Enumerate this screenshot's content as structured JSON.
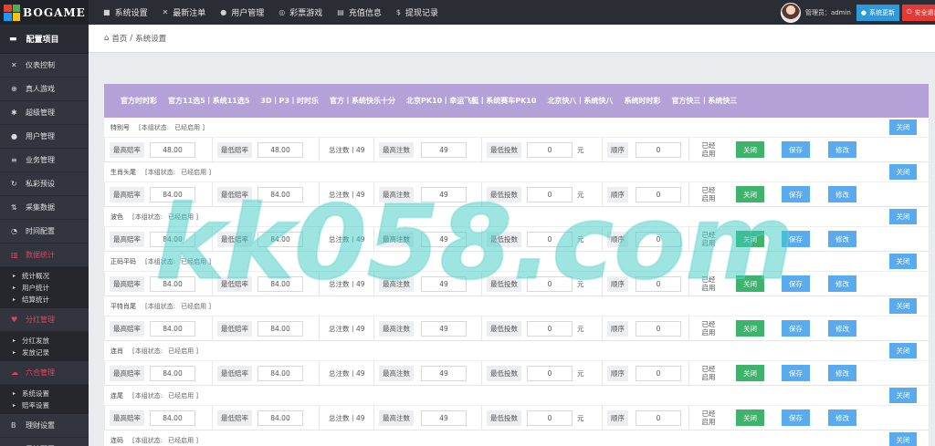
{
  "app": {
    "logo": "BOGAME"
  },
  "topnav": [
    {
      "icon": "settings-icon",
      "glyph": "■",
      "label": "系统设置"
    },
    {
      "icon": "shuffle-icon",
      "glyph": "✕",
      "label": "最新注单"
    },
    {
      "icon": "user-icon",
      "glyph": "●",
      "label": "用户管理"
    },
    {
      "icon": "target-icon",
      "glyph": "◎",
      "label": "彩票游戏"
    },
    {
      "icon": "card-icon",
      "glyph": "▤",
      "label": "充值信息"
    },
    {
      "icon": "money-icon",
      "glyph": "$",
      "label": "提现记录"
    }
  ],
  "topright": {
    "admin": "管理员：admin",
    "update": "系统更新",
    "exit": "安全退出"
  },
  "sidebar": {
    "title": "配置项目",
    "items": [
      {
        "icon": "shuffle-icon",
        "glyph": "✕",
        "label": "仪表控制",
        "active": false
      },
      {
        "icon": "plus-circle-icon",
        "glyph": "⊕",
        "label": "真人游戏",
        "active": false
      },
      {
        "icon": "gear-icon",
        "glyph": "✱",
        "label": "超级管理",
        "active": false
      },
      {
        "icon": "user-circle-icon",
        "glyph": "●",
        "label": "用户管理",
        "active": false
      },
      {
        "icon": "list-icon",
        "glyph": "≡",
        "label": "业务管理",
        "active": false
      },
      {
        "icon": "refresh-icon",
        "glyph": "↻",
        "label": "私彩预设",
        "active": false
      },
      {
        "icon": "sort-icon",
        "glyph": "⇅",
        "label": "采集数据",
        "active": false
      },
      {
        "icon": "dashboard-icon",
        "glyph": "◔",
        "label": "时间配置",
        "active": false
      },
      {
        "icon": "chart-icon",
        "glyph": "▥",
        "label": "数据统计",
        "active": true
      }
    ],
    "sub1": [
      "统计概况",
      "用户统计",
      "结算统计"
    ],
    "item2": {
      "icon": "heart-icon",
      "glyph": "♥",
      "label": "分红管理",
      "active": true
    },
    "sub2": [
      "分红发放",
      "发放记录"
    ],
    "item3": {
      "icon": "cloud-icon",
      "glyph": "☁",
      "label": "六合管理",
      "active": true
    },
    "sub3": [
      "系统设置",
      "赔率设置"
    ],
    "item4": {
      "icon": "bitcoin-icon",
      "glyph": "B",
      "label": "理财设置",
      "active": false
    },
    "item5": {
      "icon": "filter-icon",
      "glyph": "▼",
      "label": "风控配置",
      "active": false
    }
  },
  "breadcrumb": {
    "home": "首页",
    "sep": "/",
    "current": "系统设置"
  },
  "tabs": [
    "官方时时彩",
    "官方11选5丨系统11选5",
    "3D丨P3丨时时乐",
    "官方丨系统快乐十分",
    "北京PK10丨幸运飞艇丨系统赛车PK10",
    "北京快八丨系统快八",
    "系统时时彩",
    "官方快三丨系统快三"
  ],
  "labels": {
    "status_label": "[本组状态:",
    "status_value": "已经启用 ]",
    "group_close": "关闭",
    "max_odds": "最高赔率",
    "min_odds": "最低赔率",
    "total": "总注数丨49",
    "max_bets": "最高注数",
    "min_stake": "最低投数",
    "unit": "元",
    "order": "顺序",
    "enabled": "已经启用",
    "btn_close": "关闭",
    "btn_save": "保存",
    "btn_edit": "修改"
  },
  "groups": [
    {
      "head": "特别号",
      "row": "特别号",
      "max": "48.00",
      "min": "48.00",
      "bets": "49",
      "stake": "0",
      "order": "0"
    },
    {
      "head": "生肖头尾",
      "row": "生肖头尾",
      "max": "84.00",
      "min": "84.00",
      "bets": "49",
      "stake": "0",
      "order": "0"
    },
    {
      "head": "波色",
      "row": "波色",
      "max": "84.00",
      "min": "84.00",
      "bets": "49",
      "stake": "0",
      "order": "0"
    },
    {
      "head": "正码平码",
      "row": "正码平码",
      "max": "84.00",
      "min": "84.00",
      "bets": "49",
      "stake": "0",
      "order": "0"
    },
    {
      "head": "平特肖尾",
      "row": "平特肖尾",
      "max": "84.00",
      "min": "84.00",
      "bets": "49",
      "stake": "0",
      "order": "0"
    },
    {
      "head": "连肖",
      "row": "连肖",
      "max": "84.00",
      "min": "84.00",
      "bets": "49",
      "stake": "0",
      "order": "0"
    },
    {
      "head": "连尾",
      "row": "连尾",
      "max": "84.00",
      "min": "84.00",
      "bets": "49",
      "stake": "0",
      "order": "0"
    },
    {
      "head": "连码",
      "row": "",
      "max": "",
      "min": "",
      "bets": "",
      "stake": "",
      "order": ""
    }
  ],
  "watermark": "kk058.com",
  "colors": {
    "tabs_bg": "#b3a1d8",
    "sidebar_bg": "#32353d",
    "green": "#3db36b",
    "blue": "#5aaaf0",
    "active": "#e8415d"
  }
}
